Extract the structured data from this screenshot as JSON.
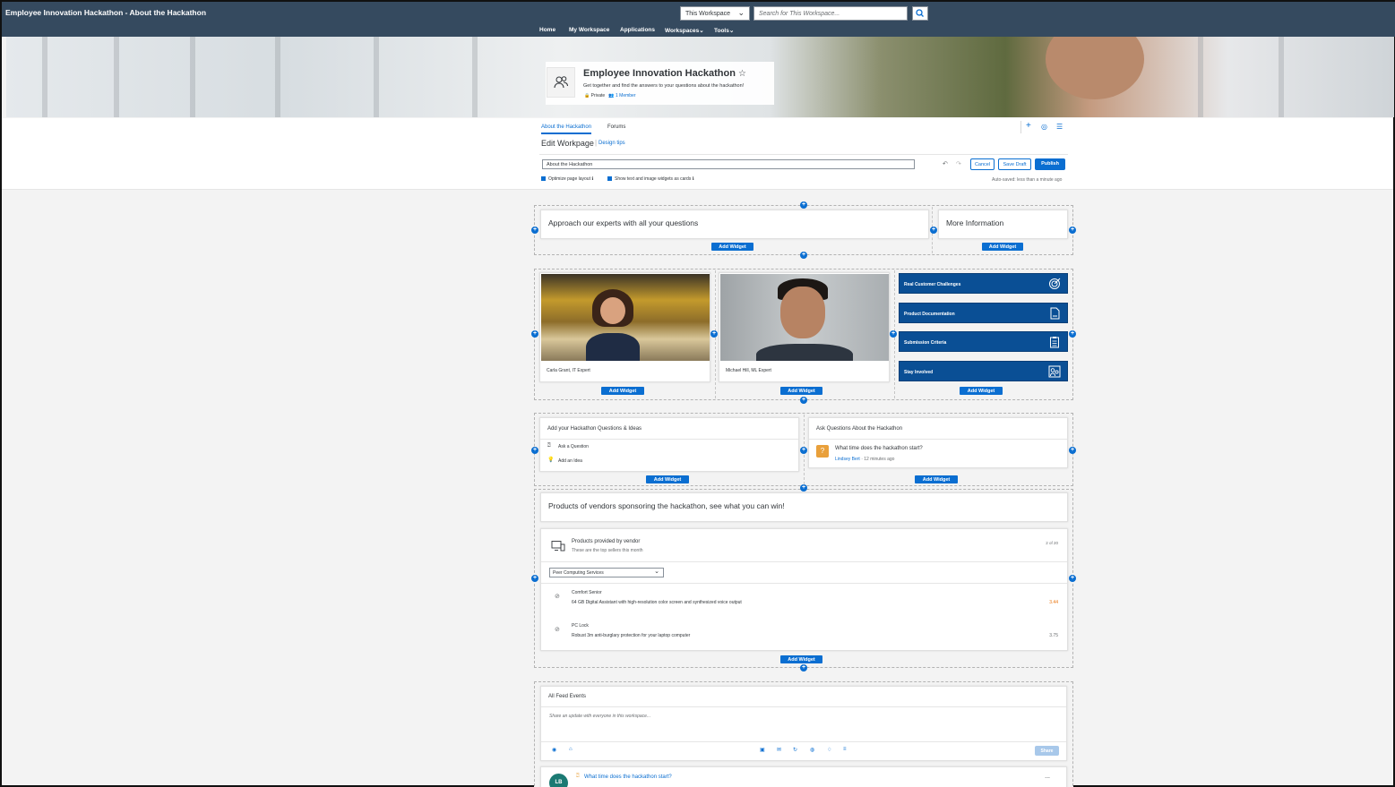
{
  "app": {
    "title": "Employee Innovation Hackathon - About the Hackathon"
  },
  "search": {
    "scope": "This Workspace",
    "placeholder": "Search for This Workspace..."
  },
  "nav": {
    "home": "Home",
    "my_workspace": "My Workspace",
    "applications": "Applications",
    "workspaces": "Workspaces",
    "tools": "Tools"
  },
  "workspace": {
    "name": "Employee Innovation Hackathon",
    "star": "☆",
    "description": "Get together and find the answers to your questions about the hackathon!",
    "privacy": "Private",
    "members": "1 Member"
  },
  "tabs": [
    "About the Hackathon",
    "Forums"
  ],
  "editor": {
    "title": "Edit Workpage",
    "design_tips": "Design tips",
    "page_name": "About the Hackathon",
    "cancel": "Cancel",
    "save_draft": "Save Draft",
    "publish": "Publish",
    "optimize_label": "Optimize page layout",
    "cards_label": "Show text and image widgets as cards",
    "autosave": "Auto-saved: less than a minute ago"
  },
  "add_widget": "Add Widget",
  "section1": {
    "left_text": "Approach our experts with all your questions",
    "right_text": "More Information"
  },
  "experts": [
    {
      "caption": "Carla Grant, IT Expert"
    },
    {
      "caption": "Michael Hill, ML Expert"
    }
  ],
  "tiles": [
    "Real Customer Challenges",
    "Product Documentation",
    "Submission Criteria",
    "Stay Involved"
  ],
  "ideas": {
    "title": "Add your Hackathon Questions & Ideas",
    "ask": "Ask a Question",
    "idea": "Add an Idea"
  },
  "questions": {
    "title": "Ask Questions About the Hackathon",
    "question": "What time does the hackathon start?",
    "author": "Lindsey Bert",
    "time": "· 12 minutes ago"
  },
  "products_text": "Products of vendors sponsoring the hackathon, see what you can win!",
  "products": {
    "title": "Products provided by vendor",
    "subtitle": "These are the top sellers this month",
    "count": "2 of 20",
    "vendor": "Peer Computing Services",
    "items": [
      {
        "name": "Comfort Senior",
        "desc": "64 GB Digital Assistant with high-resolution color screen and synthesized voice output",
        "value": "3.44",
        "value_color": "#e9730c"
      },
      {
        "name": "PC Lock",
        "desc": "Robust 3m anti-burglary protection for your laptop computer",
        "value": "3.75",
        "value_color": "#6a6d70"
      }
    ]
  },
  "feed": {
    "title": "All Feed Events",
    "placeholder": "Share an update with everyone in this workspace...",
    "share": "Share",
    "avatar": "LB",
    "post": "What time does the hackathon start?",
    "more": "..."
  },
  "colors": {
    "shell": "#354a5f",
    "accent": "#0a6ed1",
    "tile": "#0a4f95"
  }
}
